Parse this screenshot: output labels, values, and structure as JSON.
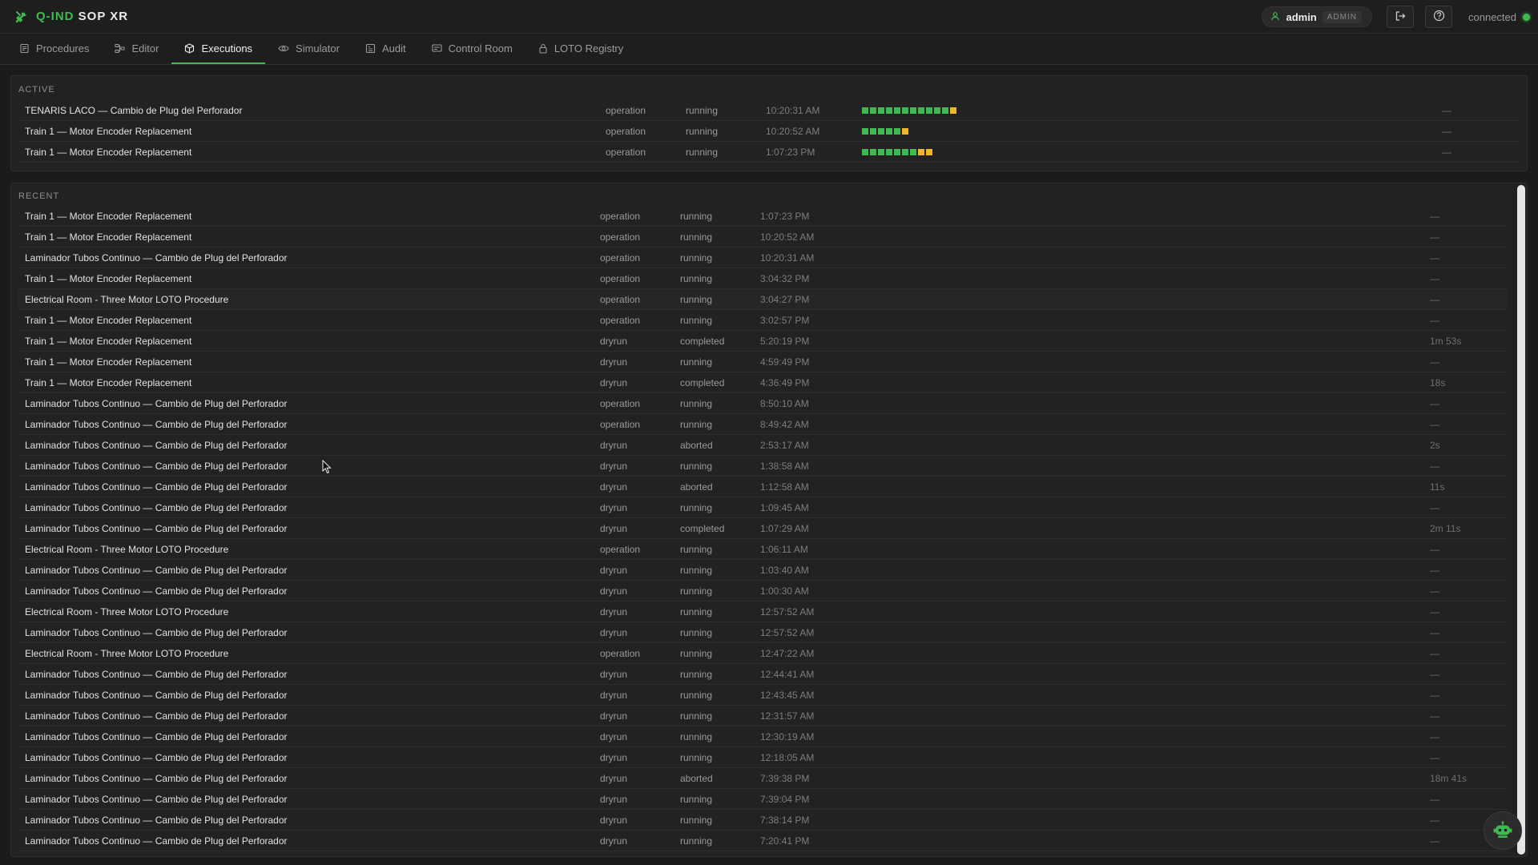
{
  "app": {
    "brand_accent": "Q-IND",
    "brand_main": "SOP XR",
    "accent_color": "#3fb950"
  },
  "user": {
    "name": "admin",
    "role": "ADMIN"
  },
  "connection": {
    "label": "connected",
    "status_color": "#3fb950"
  },
  "tabs": [
    {
      "label": "Procedures",
      "icon": "document-icon"
    },
    {
      "label": "Editor",
      "icon": "nodes-icon"
    },
    {
      "label": "Executions",
      "icon": "cube-icon",
      "active": true
    },
    {
      "label": "Simulator",
      "icon": "eye-icon"
    },
    {
      "label": "Audit",
      "icon": "clipboard-icon"
    },
    {
      "label": "Control Room",
      "icon": "monitor-icon"
    },
    {
      "label": "LOTO Registry",
      "icon": "lock-icon"
    }
  ],
  "active": {
    "title": "ACTIVE",
    "rows": [
      {
        "name": "TENARIS LACO — Cambio de Plug del Perforador",
        "type": "operation",
        "status": "running",
        "time": "10:20:31 AM",
        "progress": "gggggggggggy",
        "duration": "—"
      },
      {
        "name": "Train 1 — Motor Encoder Replacement",
        "type": "operation",
        "status": "running",
        "time": "10:20:52 AM",
        "progress": "gggggy",
        "duration": "—"
      },
      {
        "name": "Train 1 — Motor Encoder Replacement",
        "type": "operation",
        "status": "running",
        "time": "1:07:23 PM",
        "progress": "gggggggyy",
        "duration": "—"
      }
    ]
  },
  "recent": {
    "title": "RECENT",
    "rows": [
      {
        "name": "Train 1 — Motor Encoder Replacement",
        "type": "operation",
        "status": "running",
        "time": "1:07:23 PM",
        "duration": "—"
      },
      {
        "name": "Train 1 — Motor Encoder Replacement",
        "type": "operation",
        "status": "running",
        "time": "10:20:52 AM",
        "duration": "—"
      },
      {
        "name": "Laminador Tubos Continuo — Cambio de Plug del Perforador",
        "type": "operation",
        "status": "running",
        "time": "10:20:31 AM",
        "duration": "—"
      },
      {
        "name": "Train 1 — Motor Encoder Replacement",
        "type": "operation",
        "status": "running",
        "time": "3:04:32 PM",
        "duration": "—"
      },
      {
        "name": "Electrical Room - Three Motor LOTO Procedure",
        "type": "operation",
        "status": "running",
        "time": "3:04:27 PM",
        "duration": "—"
      },
      {
        "name": "Train 1 — Motor Encoder Replacement",
        "type": "operation",
        "status": "running",
        "time": "3:02:57 PM",
        "duration": "—"
      },
      {
        "name": "Train 1 — Motor Encoder Replacement",
        "type": "dryrun",
        "status": "completed",
        "time": "5:20:19 PM",
        "duration": "1m 53s"
      },
      {
        "name": "Train 1 — Motor Encoder Replacement",
        "type": "dryrun",
        "status": "running",
        "time": "4:59:49 PM",
        "duration": "—"
      },
      {
        "name": "Train 1 — Motor Encoder Replacement",
        "type": "dryrun",
        "status": "completed",
        "time": "4:36:49 PM",
        "duration": "18s"
      },
      {
        "name": "Laminador Tubos Continuo — Cambio de Plug del Perforador",
        "type": "operation",
        "status": "running",
        "time": "8:50:10 AM",
        "duration": "—"
      },
      {
        "name": "Laminador Tubos Continuo — Cambio de Plug del Perforador",
        "type": "operation",
        "status": "running",
        "time": "8:49:42 AM",
        "duration": "—"
      },
      {
        "name": "Laminador Tubos Continuo — Cambio de Plug del Perforador",
        "type": "dryrun",
        "status": "aborted",
        "time": "2:53:17 AM",
        "duration": "2s"
      },
      {
        "name": "Laminador Tubos Continuo — Cambio de Plug del Perforador",
        "type": "dryrun",
        "status": "running",
        "time": "1:38:58 AM",
        "duration": "—"
      },
      {
        "name": "Laminador Tubos Continuo — Cambio de Plug del Perforador",
        "type": "dryrun",
        "status": "aborted",
        "time": "1:12:58 AM",
        "duration": "11s"
      },
      {
        "name": "Laminador Tubos Continuo — Cambio de Plug del Perforador",
        "type": "dryrun",
        "status": "running",
        "time": "1:09:45 AM",
        "duration": "—"
      },
      {
        "name": "Laminador Tubos Continuo — Cambio de Plug del Perforador",
        "type": "dryrun",
        "status": "completed",
        "time": "1:07:29 AM",
        "duration": "2m 11s"
      },
      {
        "name": "Electrical Room - Three Motor LOTO Procedure",
        "type": "operation",
        "status": "running",
        "time": "1:06:11 AM",
        "duration": "—"
      },
      {
        "name": "Laminador Tubos Continuo — Cambio de Plug del Perforador",
        "type": "dryrun",
        "status": "running",
        "time": "1:03:40 AM",
        "duration": "—"
      },
      {
        "name": "Laminador Tubos Continuo — Cambio de Plug del Perforador",
        "type": "dryrun",
        "status": "running",
        "time": "1:00:30 AM",
        "duration": "—"
      },
      {
        "name": "Electrical Room - Three Motor LOTO Procedure",
        "type": "dryrun",
        "status": "running",
        "time": "12:57:52 AM",
        "duration": "—"
      },
      {
        "name": "Laminador Tubos Continuo — Cambio de Plug del Perforador",
        "type": "dryrun",
        "status": "running",
        "time": "12:57:52 AM",
        "duration": "—"
      },
      {
        "name": "Electrical Room - Three Motor LOTO Procedure",
        "type": "operation",
        "status": "running",
        "time": "12:47:22 AM",
        "duration": "—"
      },
      {
        "name": "Laminador Tubos Continuo — Cambio de Plug del Perforador",
        "type": "dryrun",
        "status": "running",
        "time": "12:44:41 AM",
        "duration": "—"
      },
      {
        "name": "Laminador Tubos Continuo — Cambio de Plug del Perforador",
        "type": "dryrun",
        "status": "running",
        "time": "12:43:45 AM",
        "duration": "—"
      },
      {
        "name": "Laminador Tubos Continuo — Cambio de Plug del Perforador",
        "type": "dryrun",
        "status": "running",
        "time": "12:31:57 AM",
        "duration": "—"
      },
      {
        "name": "Laminador Tubos Continuo — Cambio de Plug del Perforador",
        "type": "dryrun",
        "status": "running",
        "time": "12:30:19 AM",
        "duration": "—"
      },
      {
        "name": "Laminador Tubos Continuo — Cambio de Plug del Perforador",
        "type": "dryrun",
        "status": "running",
        "time": "12:18:05 AM",
        "duration": "—"
      },
      {
        "name": "Laminador Tubos Continuo — Cambio de Plug del Perforador",
        "type": "dryrun",
        "status": "aborted",
        "time": "7:39:38 PM",
        "duration": "18m 41s"
      },
      {
        "name": "Laminador Tubos Continuo — Cambio de Plug del Perforador",
        "type": "dryrun",
        "status": "running",
        "time": "7:39:04 PM",
        "duration": "—"
      },
      {
        "name": "Laminador Tubos Continuo — Cambio de Plug del Perforador",
        "type": "dryrun",
        "status": "running",
        "time": "7:38:14 PM",
        "duration": "—"
      },
      {
        "name": "Laminador Tubos Continuo — Cambio de Plug del Perforador",
        "type": "dryrun",
        "status": "running",
        "time": "7:20:41 PM",
        "duration": "—"
      }
    ]
  }
}
